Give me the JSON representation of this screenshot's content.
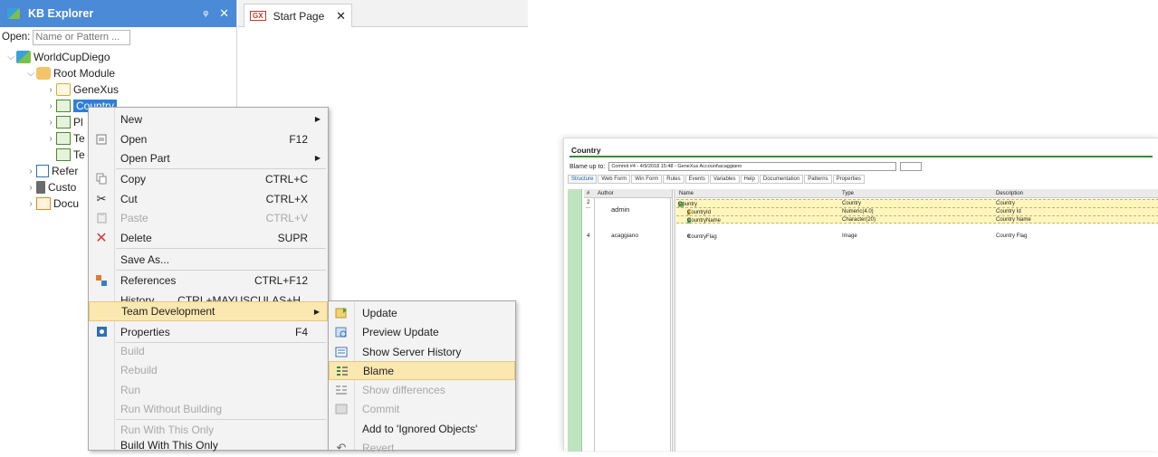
{
  "kb_explorer": {
    "title": "KB Explorer",
    "pin_glyph": "ᵠ",
    "close_glyph": "✕",
    "open_label": "Open:",
    "open_placeholder": "Name or Pattern ...",
    "tree": {
      "root": "WorldCupDiego",
      "module": "Root Module",
      "genexus": "GeneXus",
      "country": "Country",
      "pl": "Pl",
      "te1": "Te",
      "te2": "Te",
      "refer": "Refer",
      "custo": "Custo",
      "docu": "Docu"
    }
  },
  "document_tab": {
    "icon_text": "GX",
    "label": "Start Page",
    "close_glyph": "✕"
  },
  "context_menu": {
    "new": "New",
    "open": "Open",
    "open_sc": "F12",
    "open_part": "Open Part",
    "copy": "Copy",
    "copy_sc": "CTRL+C",
    "cut": "Cut",
    "cut_sc": "CTRL+X",
    "paste": "Paste",
    "paste_sc": "CTRL+V",
    "delete": "Delete",
    "delete_sc": "SUPR",
    "save_as": "Save As...",
    "references": "References",
    "references_sc": "CTRL+F12",
    "history": "History",
    "history_sc": "CTRL+MAYUSCULAS+H",
    "team_dev": "Team Development",
    "properties": "Properties",
    "properties_sc": "F4",
    "build": "Build",
    "rebuild": "Rebuild",
    "run": "Run",
    "run_wo_build": "Run Without Building",
    "run_with_only": "Run With This Only",
    "build_with_only": "Build With This Only"
  },
  "submenu": {
    "update": "Update",
    "preview_update": "Preview Update",
    "show_server_history": "Show Server History",
    "blame": "Blame",
    "show_differences": "Show differences",
    "commit": "Commit",
    "add_ignored": "Add to 'Ignored Objects'",
    "revert": "Revert"
  },
  "blame_view": {
    "title": "Country",
    "blame_up_to_label": "Blame up to:",
    "commit_value": "Commit #4 - 4/9/2018 15:48 - GeneXus Account\\acaggiano",
    "tabs": [
      "Structure",
      "Web Form",
      "Win Form",
      "Rules",
      "Events",
      "Variables",
      "Help",
      "Documentation",
      "Patterns",
      "Properties"
    ],
    "headers": {
      "num": "#",
      "author": "Author",
      "name": "Name",
      "type": "Type",
      "description": "Description"
    },
    "groups": [
      {
        "num": "2",
        "dots": "...",
        "author": "admin"
      },
      {
        "num": "4",
        "dots": "",
        "author": "acaggiano"
      }
    ],
    "rows": [
      {
        "name": "Country",
        "type": "Country",
        "description": "Country"
      },
      {
        "name": "CountryId",
        "type": "Numeric(4.0)",
        "description": "Country Id"
      },
      {
        "name": "CountryName",
        "type": "Character(20)",
        "description": "Country Name"
      },
      {
        "name": "CountryFlag",
        "type": "Image",
        "description": "Country Flag"
      }
    ]
  }
}
